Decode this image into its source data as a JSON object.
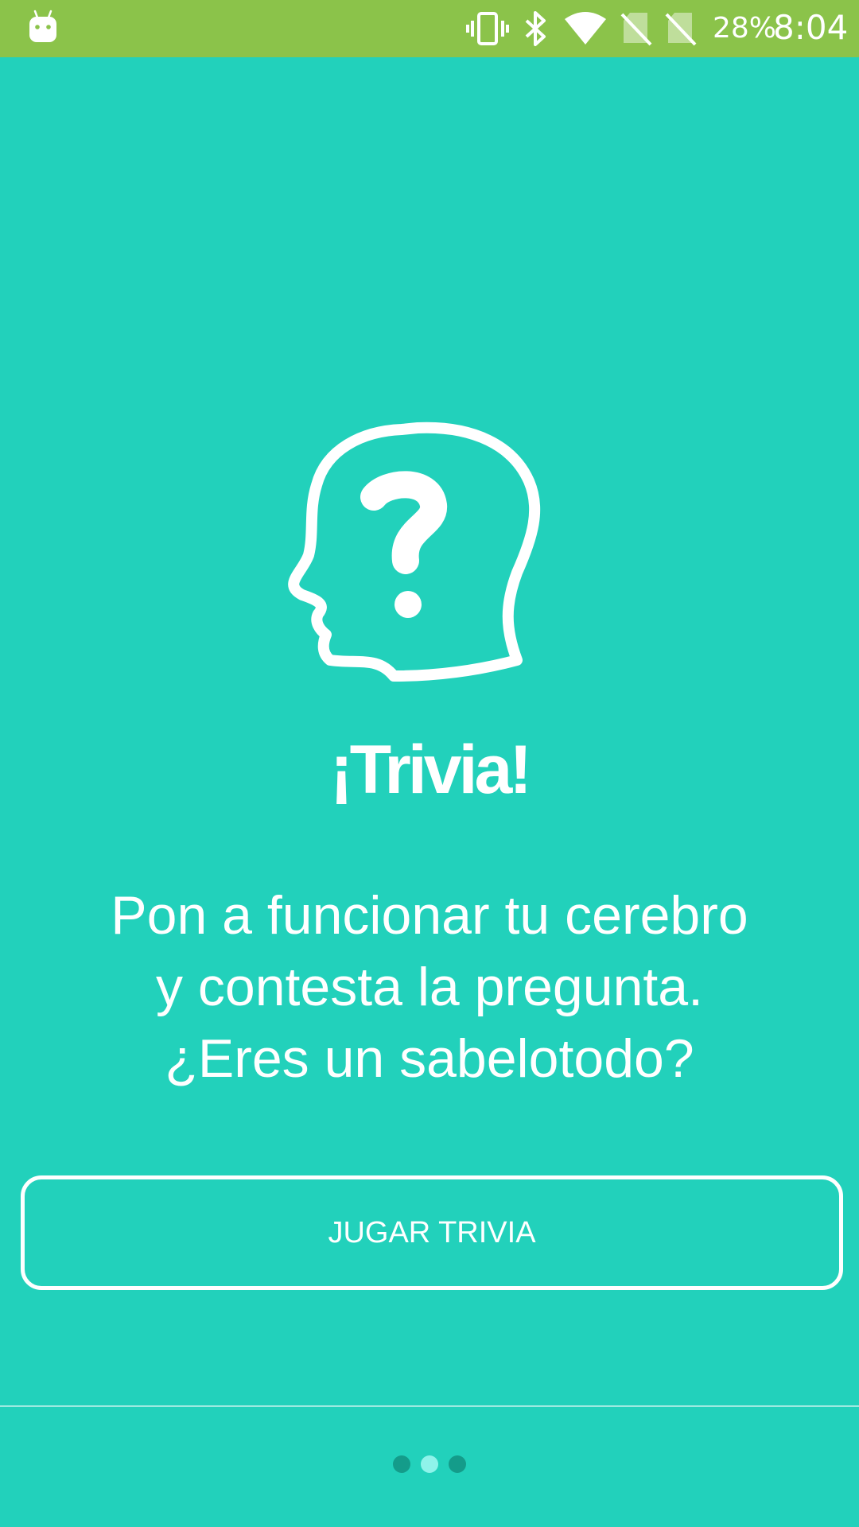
{
  "status_bar": {
    "battery": "28%",
    "time": "8:04",
    "icons": [
      "android-icon",
      "vibrate-icon",
      "bluetooth-icon",
      "wifi-icon",
      "no-sim-icon",
      "no-sim-icon"
    ],
    "background": "#8bc34a"
  },
  "main": {
    "icon": "head-question-icon",
    "title": "¡Trivia!",
    "description_lines": [
      "Pon a funcionar tu cerebro",
      "y contesta la pregunta.",
      "¿Eres un sabelotodo?"
    ],
    "button_label": "JUGAR TRIVIA",
    "background": "#22d1bb"
  },
  "pager": {
    "total": 3,
    "active_index": 1
  }
}
